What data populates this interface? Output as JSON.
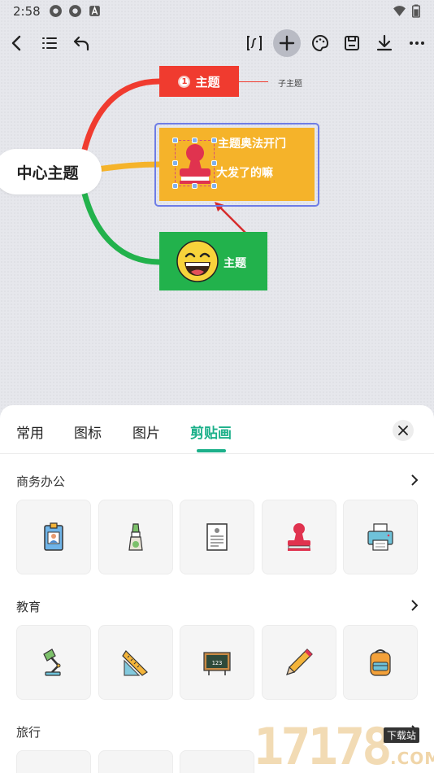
{
  "status_bar": {
    "time": "2:58",
    "icons": [
      "network-icon",
      "network-icon",
      "notification-a-icon",
      "wifi-icon",
      "battery-icon"
    ]
  },
  "toolbar": {
    "icons": [
      "back-icon",
      "outline-icon",
      "undo-icon",
      "formula-icon",
      "add-icon",
      "palette-icon",
      "save-icon",
      "download-icon",
      "more-icon"
    ]
  },
  "mindmap": {
    "center": "中心主题",
    "red_node": {
      "badge": "1",
      "label": "主题",
      "color": "#f03b2f"
    },
    "subtopic": "子主题",
    "yellow_node": {
      "line1": "主题奥法开门",
      "line2": "大发了的嘛",
      "color": "#f5b32a",
      "image": "stamp-icon"
    },
    "green_node": {
      "label": "主题",
      "color": "#22b24c",
      "image": "laughing-face-icon"
    }
  },
  "sheet": {
    "tabs": [
      {
        "label": "常用",
        "active": false
      },
      {
        "label": "图标",
        "active": false
      },
      {
        "label": "图片",
        "active": false
      },
      {
        "label": "剪贴画",
        "active": true
      }
    ],
    "accent": "#1cb08a",
    "sections": [
      {
        "title": "商务办公",
        "items": [
          "id-badge-icon",
          "glue-bottle-icon",
          "document-icon",
          "stamp-icon",
          "printer-icon"
        ]
      },
      {
        "title": "教育",
        "items": [
          "desk-lamp-icon",
          "ruler-triangle-icon",
          "blackboard-icon",
          "pencil-icon",
          "backpack-icon"
        ]
      },
      {
        "title": "旅行",
        "items": []
      }
    ]
  },
  "watermark": {
    "digits": "17178",
    "badge": "下载站",
    "suffix": ".COM"
  }
}
